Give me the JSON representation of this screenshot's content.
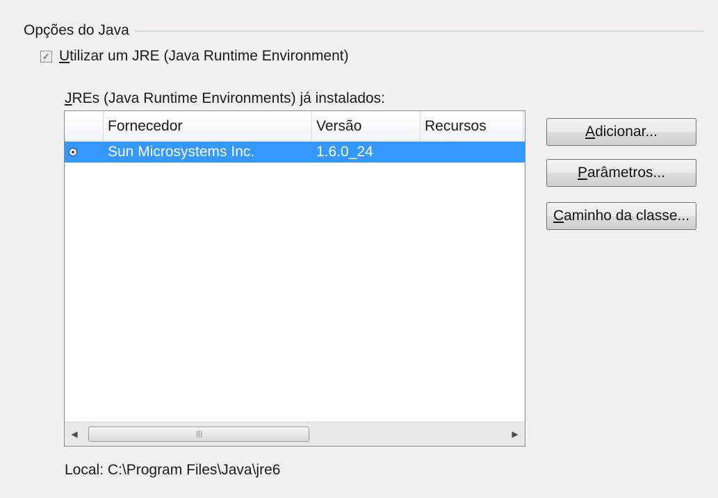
{
  "group": {
    "title": "Opções do Java"
  },
  "checkbox": {
    "accel": "U",
    "label_rest": "tilizar um JRE (Java Runtime Environment)",
    "checked": true
  },
  "list_label": {
    "accel": "J",
    "rest": "REs (Java Runtime Environments) já instalados:"
  },
  "table": {
    "columns": [
      "",
      "Fornecedor",
      "Versão",
      "Recursos"
    ],
    "rows": [
      {
        "selected": true,
        "vendor": "Sun Microsystems Inc.",
        "version": "1.6.0_24",
        "features": ""
      }
    ]
  },
  "buttons": {
    "add": {
      "accel": "A",
      "rest": "dicionar..."
    },
    "params": {
      "accel": "P",
      "rest": "arâmetros..."
    },
    "classpath": {
      "accel": "C",
      "rest": "aminho da classe..."
    }
  },
  "location": "Local: C:\\Program Files\\Java\\jre6",
  "colors": {
    "selection": "#3399ff",
    "background": "#f0f0f0"
  },
  "icons": {
    "scroll_left": "arrow-left-icon",
    "scroll_right": "arrow-right-icon"
  }
}
